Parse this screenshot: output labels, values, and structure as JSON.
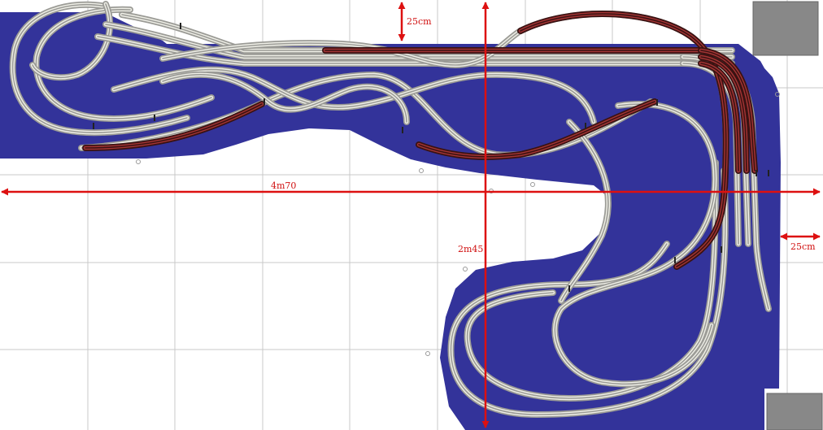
{
  "dimensions": {
    "top_margin": "25cm",
    "width": "4m70",
    "height": "2m45",
    "right_margin": "25cm"
  },
  "colors": {
    "board": "#33339a",
    "grid": "#c8c8c8",
    "track_tie": "#9b9b96",
    "track_rail": "#eeeee6",
    "hidden_tie": "#3a1212",
    "hidden_rail": "#a23434",
    "dimension": "#dd1010",
    "fixture": "#888888"
  }
}
